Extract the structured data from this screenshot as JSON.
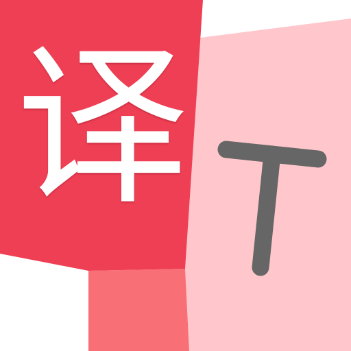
{
  "icon": {
    "source_glyph": "译",
    "target_glyph": "T",
    "colors": {
      "background": "#ffffff",
      "source_card": "#ef3f54",
      "source_tail": "#f86f76",
      "target_card": "#ffc7cc",
      "source_glyph": "#ffffff",
      "target_glyph": "#666666"
    }
  }
}
